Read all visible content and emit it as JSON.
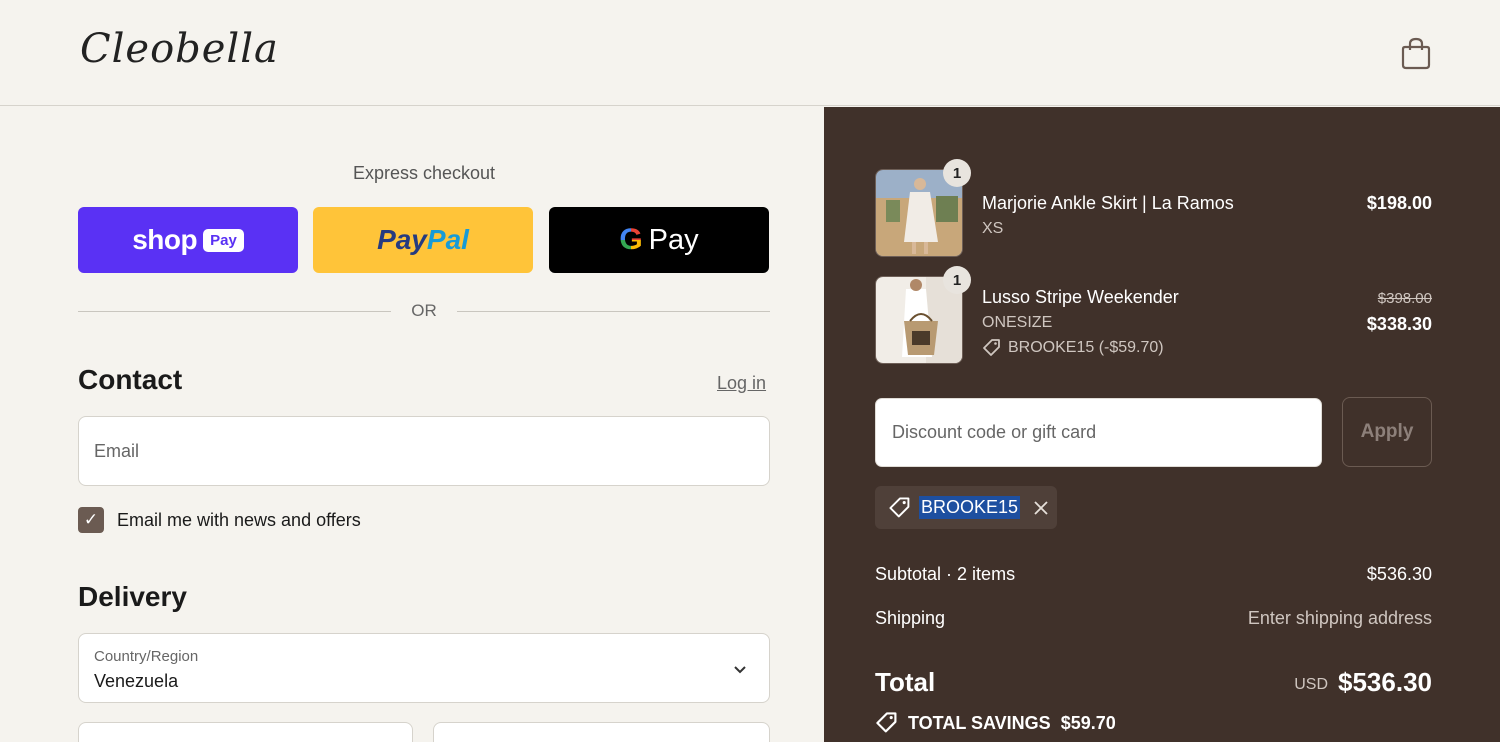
{
  "header": {
    "logo_text": "Cleobella",
    "cart_icon": "shopping-bag-icon"
  },
  "express": {
    "title": "Express checkout",
    "shop_pay": {
      "word": "shop",
      "badge": "Pay",
      "color": "#5a31f4"
    },
    "paypal": {
      "part1": "Pay",
      "part2": "Pal",
      "color": "#ffc439"
    },
    "gpay": {
      "g": "G",
      "pay": "Pay",
      "color": "#000000"
    },
    "or_text": "OR"
  },
  "contact": {
    "title": "Contact",
    "login_label": "Log in",
    "email_placeholder": "Email",
    "news_checked": true,
    "news_label": "Email me with news and offers"
  },
  "delivery": {
    "title": "Delivery",
    "country_label": "Country/Region",
    "country_value": "Venezuela"
  },
  "summary": {
    "items": [
      {
        "name": "Marjorie Ankle Skirt | La Ramos",
        "variant": "XS",
        "qty": "1",
        "price": "$198.00"
      },
      {
        "name": "Lusso Stripe Weekender",
        "variant": "ONESIZE",
        "qty": "1",
        "old_price": "$398.00",
        "price": "$338.30",
        "discount": "BROOKE15 (-$59.70)"
      }
    ],
    "discount_placeholder": "Discount code or gift card",
    "apply_label": "Apply",
    "applied_code": "BROOKE15",
    "subtotal_label": "Subtotal · 2 items",
    "subtotal_value": "$536.30",
    "shipping_label": "Shipping",
    "shipping_value": "Enter shipping address",
    "total_label": "Total",
    "total_currency": "USD",
    "total_value": "$536.30",
    "savings_label": "TOTAL SAVINGS",
    "savings_value": "$59.70"
  },
  "colors": {
    "summary_bg": "#40312a",
    "page_bg": "#f5f3ee",
    "highlight": "#1d4fa0"
  }
}
